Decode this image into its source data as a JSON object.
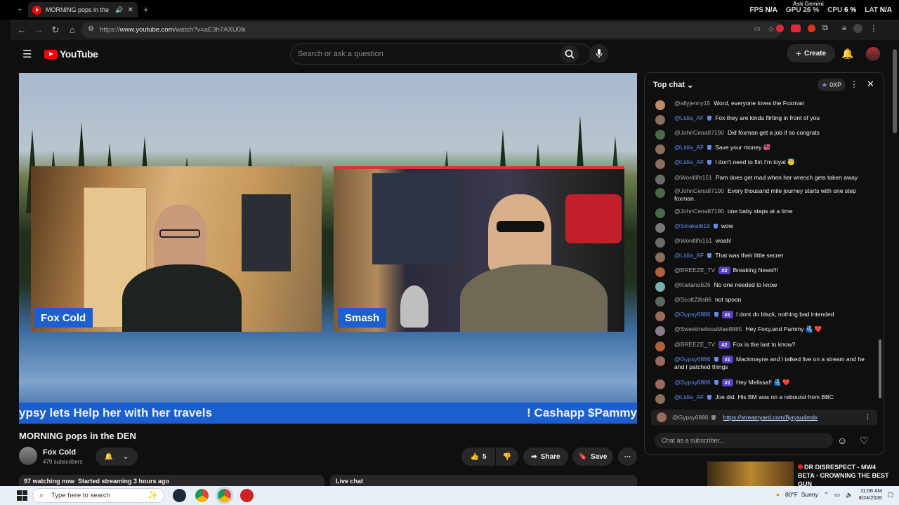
{
  "browser": {
    "tab_title": "MORNING pops in the DEN",
    "url_prefix": "https://",
    "url_host": "www.youtube.com",
    "url_path": "/watch?v=aE3h7AXU0lk",
    "overlay": {
      "fps_label": "FPS",
      "fps": "N/A",
      "gpu": "GPU 26 %",
      "cpu_label": "CPU",
      "cpu": "6 %",
      "lat_label": "LAT",
      "lat": "N/A",
      "gemini": "Ask Gemini"
    }
  },
  "masthead": {
    "logo_text": "YouTube",
    "search_placeholder": "Search or ask a question",
    "create_label": "Create"
  },
  "video": {
    "left_name": "Fox Cold",
    "right_name": "Smash",
    "ticker_left": "ypsy lets Help her with her travels",
    "ticker_right": "! Cashapp $Pammy"
  },
  "watch": {
    "title": "MORNING pops in the DEN",
    "channel_name": "Fox Cold",
    "subscribers": "479 subscribers",
    "likes": "5",
    "share_label": "Share",
    "save_label": "Save",
    "description_line": "97 watching now  Started streaming 3 hours ago",
    "live_chat_label": "Live chat"
  },
  "chat": {
    "header": "Top chat",
    "xp": "0XP",
    "messages": [
      {
        "user": "@allyjenny15",
        "text": "Word, everyone loves the Foxman",
        "mod": false,
        "color": "#c08a6a"
      },
      {
        "user": "@Lidia_AF",
        "text": "Fox they are kinda flirting in front of you",
        "mod": true,
        "color": "#8a6d5a"
      },
      {
        "user": "@JohnCena87190",
        "text": "Did foxman get a job if so congrats",
        "mod": false,
        "color": "#4a6a4a"
      },
      {
        "user": "@Lidia_AF",
        "text": "Save your money 💞",
        "mod": true,
        "color": "#8a6d5a"
      },
      {
        "user": "@Lidia_AF",
        "text": "I don't need to flirt I'm loyal 😇",
        "mod": true,
        "color": "#8a6d5a"
      },
      {
        "user": "@Wordlife151",
        "text": "Pam does get mad when her wrench gets taken away",
        "mod": false,
        "color": "#6a6a6a"
      },
      {
        "user": "@JohnCena87190",
        "text": "Every thousand mile journey starts with one step foxman.",
        "mod": false,
        "color": "#4a6a4a"
      },
      {
        "user": "@JohnCena87190",
        "text": "one baby steps at a time",
        "mod": false,
        "color": "#4a6a4a"
      },
      {
        "user": "@Sinakal619",
        "text": "wow",
        "mod": true,
        "color": "#777"
      },
      {
        "user": "@Wordlife151",
        "text": "woah!",
        "mod": false,
        "color": "#6a6a6a"
      },
      {
        "user": "@Lidia_AF",
        "text": "That was their little secret",
        "mod": true,
        "color": "#8a6d5a"
      },
      {
        "user": "@BREEZE_TV",
        "text": "Breaking News!!!",
        "mod": false,
        "badge": "#2",
        "color": "#b0603a"
      },
      {
        "user": "@Kaitana626",
        "text": "No one needed to know",
        "mod": false,
        "color": "#7ab0b0"
      },
      {
        "user": "@ScottZilla86",
        "text": "not spoon",
        "mod": false,
        "color": "#5a6a5a"
      },
      {
        "user": "@Gypsy6886",
        "text": "I dont do black, nothing bad intended",
        "mod": true,
        "badge": "#1",
        "color": "#9a6a5a"
      },
      {
        "user": "@SweetmelissaMae8885",
        "text": "Hey Foxy,and Pammy 🫂 ❤️",
        "mod": false,
        "color": "#8a7a8a"
      },
      {
        "user": "@BREEZE_TV",
        "text": "Fox is the last to know?",
        "mod": false,
        "badge": "#2",
        "color": "#b0603a"
      },
      {
        "user": "@Gypsy6886",
        "text": "Mackmayne and I talked live on a stream and he and I patched things",
        "mod": true,
        "badge": "#1",
        "color": "#9a6a5a"
      },
      {
        "user": "@Gypsy6886",
        "text": "Hey Melissa!! 🫂 ❤️",
        "mod": true,
        "badge": "#1",
        "color": "#9a6a5a"
      },
      {
        "user": "@Lidia_AF",
        "text": "Joe did. His BM was on a rebound from BBC",
        "mod": true,
        "color": "#8a6d5a"
      }
    ],
    "pinned_user": "@Gypsy6886",
    "pinned_link": "https://streamyard.com/8yrysu4mdx",
    "input_placeholder": "Chat as a subscriber..."
  },
  "recommended": {
    "title": "DR DISRESPECT - MW4 BETA - CROWNING THE BEST GUN"
  },
  "taskbar": {
    "search_placeholder": "Type here to search",
    "weather": "80°F  Sunny",
    "time": "11:08 AM",
    "date": "8/24/2026"
  }
}
